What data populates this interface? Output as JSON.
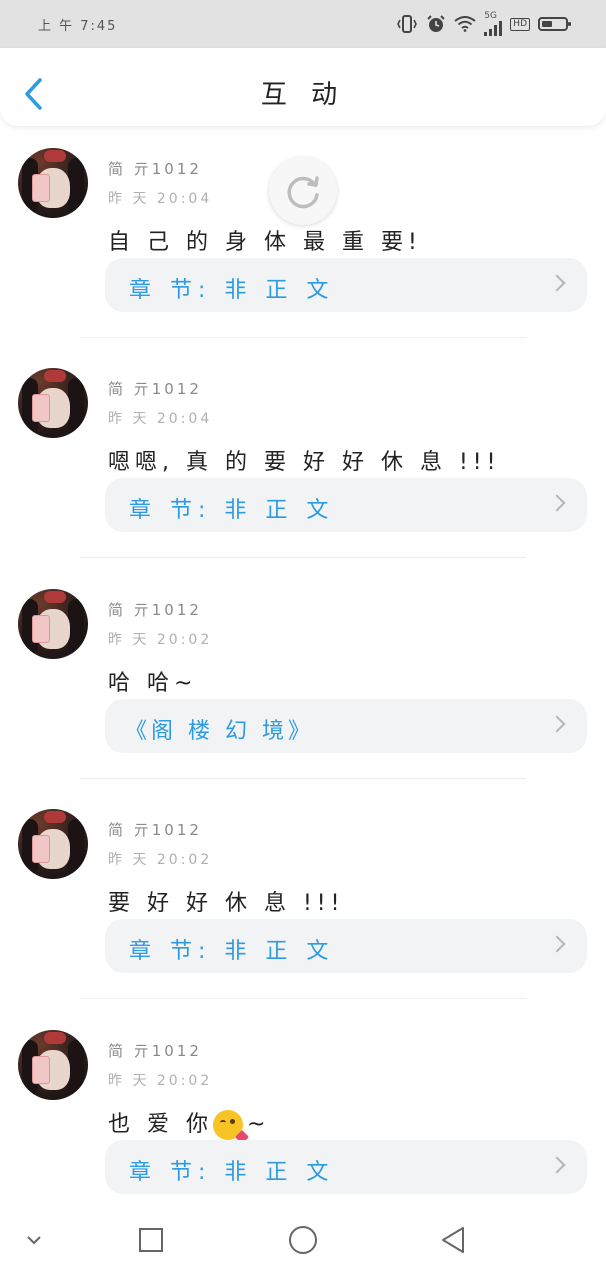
{
  "status_bar": {
    "time": "上 午 7:45",
    "network_label": "5G",
    "battery_level": 0.45,
    "icons": [
      "vibrate-icon",
      "alarm-icon",
      "wifi-icon",
      "signal-icon",
      "hd-icon",
      "battery-icon"
    ]
  },
  "header": {
    "title": "互 动",
    "back_icon": "chevron-left-icon"
  },
  "comments": [
    {
      "user": "简 亓1012",
      "time": "昨 天 20:04",
      "text": "自 己 的 身 体 最 重 要!",
      "source": "章 节: 非 正 文"
    },
    {
      "user": "简 亓1012",
      "time": "昨 天 20:04",
      "text": "嗯嗯, 真 的 要 好 好 休 息 !!!",
      "source": "章 节: 非 正 文"
    },
    {
      "user": "简 亓1012",
      "time": "昨 天 20:02",
      "text": "哈 哈~",
      "source": "《阁 楼 幻 境》"
    },
    {
      "user": "简 亓1012",
      "time": "昨 天 20:02",
      "text": "要 好 好 休 息 !!!",
      "source": "章 节: 非 正 文"
    },
    {
      "user": "简 亓1012",
      "time": "昨 天 20:02",
      "text": "也 爱 你",
      "text_suffix": "~",
      "emoji": "kissing-heart-emoji",
      "source": "章 节: 非 正 文"
    }
  ],
  "floating": {
    "refresh_icon": "refresh-icon"
  },
  "system_nav": {
    "keys": [
      "collapse-chevron-icon",
      "recents-square-icon",
      "home-circle-icon",
      "back-triangle-icon"
    ]
  },
  "colors": {
    "accent": "#2d9be0",
    "status_bar_bg": "#e2e2e2",
    "source_box_bg": "#f2f3f5"
  }
}
